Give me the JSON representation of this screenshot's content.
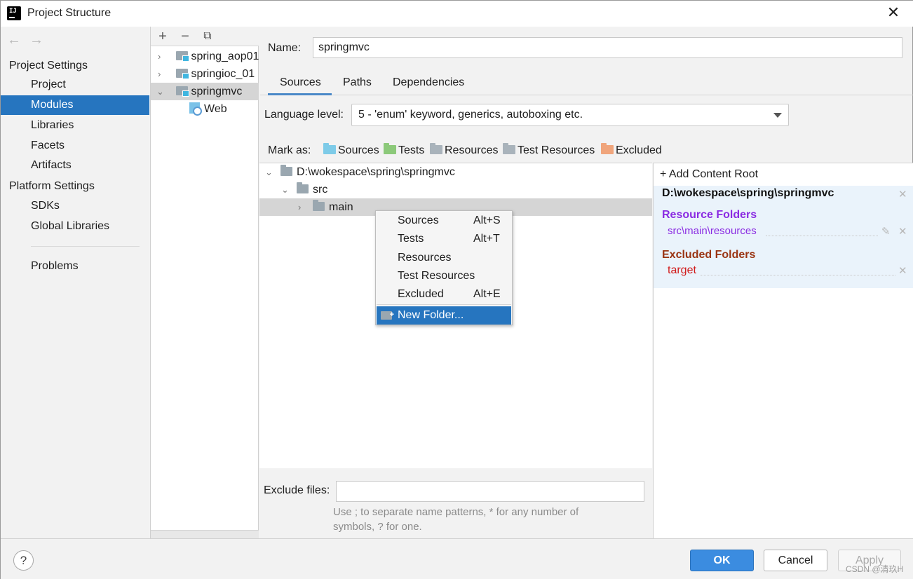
{
  "window": {
    "title": "Project Structure",
    "close": "✕"
  },
  "nav": {
    "back": "←",
    "forward": "→"
  },
  "sidebar": {
    "project_settings": "Project Settings",
    "items_project": [
      {
        "label": "Project"
      },
      {
        "label": "Modules"
      },
      {
        "label": "Libraries"
      },
      {
        "label": "Facets"
      },
      {
        "label": "Artifacts"
      }
    ],
    "platform_settings": "Platform Settings",
    "items_platform": [
      {
        "label": "SDKs"
      },
      {
        "label": "Global Libraries"
      }
    ],
    "problems": "Problems",
    "selected": "Modules"
  },
  "modules": {
    "toolbar": {
      "add": "+",
      "remove": "−",
      "copy": "⧉"
    },
    "items": [
      {
        "label": "spring_aop01",
        "chevron": "›"
      },
      {
        "label": "springioc_01",
        "chevron": "›"
      },
      {
        "label": "springmvc",
        "chevron": "⌄"
      }
    ],
    "child": {
      "label": "Web"
    }
  },
  "main": {
    "name_label": "Name:",
    "name_value": "springmvc",
    "tabs": [
      {
        "label": "Sources"
      },
      {
        "label": "Paths"
      },
      {
        "label": "Dependencies"
      }
    ],
    "language_label": "Language level:",
    "language_value": "5 - 'enum' keyword, generics, autoboxing etc.",
    "mark_as": {
      "label": "Mark as:",
      "items": [
        {
          "label": "Sources",
          "color": "#7ecbe8"
        },
        {
          "label": "Tests",
          "color": "#8cc97a"
        },
        {
          "label": "Resources",
          "color": "#a9b3bb"
        },
        {
          "label": "Test Resources",
          "color": "#a9b3bb"
        },
        {
          "label": "Excluded",
          "color": "#f0a57c"
        }
      ]
    },
    "tree": {
      "root": {
        "label": "D:\\wokespace\\spring\\springmvc",
        "chevron": "⌄"
      },
      "src": {
        "label": "src",
        "chevron": "⌄"
      },
      "main": {
        "label": "main",
        "chevron": "›"
      }
    },
    "context_menu": {
      "items": [
        {
          "label": "Sources",
          "shortcut": "Alt+S"
        },
        {
          "label": "Tests",
          "shortcut": "Alt+T"
        },
        {
          "label": "Resources",
          "shortcut": ""
        },
        {
          "label": "Test Resources",
          "shortcut": ""
        },
        {
          "label": "Excluded",
          "shortcut": "Alt+E"
        }
      ],
      "new_folder": "New Folder..."
    },
    "exclude_label": "Exclude files:",
    "exclude_value": "",
    "hint_line1": "Use ; to separate name patterns, * for any number of",
    "hint_line2": "symbols, ? for one."
  },
  "content_root": {
    "add_label": "+ Add Content Root",
    "path": "D:\\wokespace\\spring\\springmvc",
    "resource_title": "Resource Folders",
    "resource_title_color": "#8a2be2",
    "resource_path": "src\\main\\resources",
    "excluded_title": "Excluded Folders",
    "excluded_title_color": "#9a3412",
    "excluded_path": "target",
    "excluded_path_color": "#d11a1a",
    "remove": "✕",
    "edit_icon": "✎"
  },
  "footer": {
    "help": "?",
    "ok": "OK",
    "cancel": "Cancel",
    "apply": "Apply",
    "watermark": "CSDN @清玖H"
  }
}
